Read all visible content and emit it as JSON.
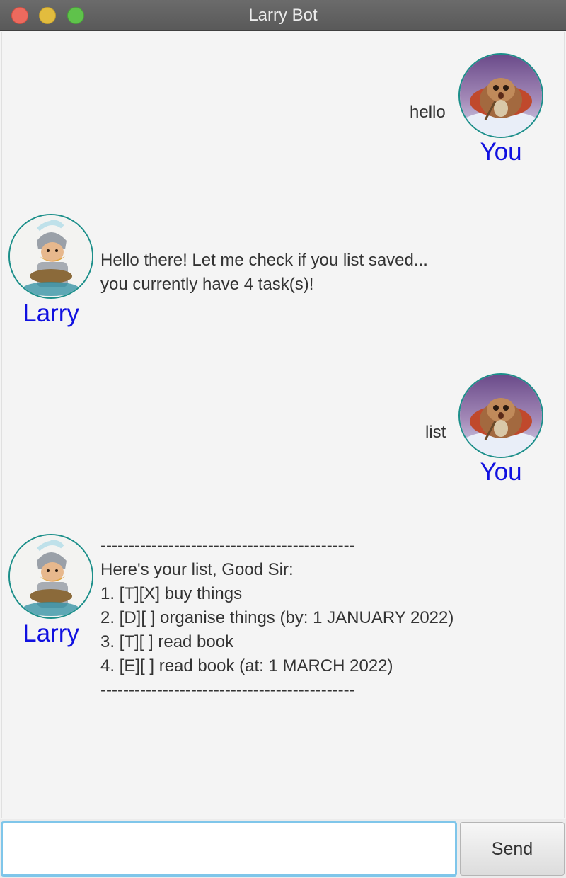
{
  "window": {
    "title": "Larry Bot"
  },
  "colors": {
    "speaker_name": "#1010e0",
    "avatar_border": "#1c8f8a",
    "input_focus_border": "#7fc6ea"
  },
  "messages": [
    {
      "sender": "You",
      "align": "right",
      "avatar_icon": "user-creature-avatar",
      "text": "hello"
    },
    {
      "sender": "Larry",
      "align": "left",
      "avatar_icon": "larry-knight-avatar",
      "text": "Hello there! Let me check if you list saved...\nyou currently have 4 task(s)!"
    },
    {
      "sender": "You",
      "align": "right",
      "avatar_icon": "user-creature-avatar",
      "text": "list"
    },
    {
      "sender": "Larry",
      "align": "left",
      "avatar_icon": "larry-knight-avatar",
      "text": "---------------------------------------------\nHere's your list, Good Sir:\n1. [T][X] buy things\n2. [D][ ] organise things (by: 1 JANUARY 2022)\n3. [T][ ] read book\n4. [E][ ] read book (at: 1 MARCH 2022)\n---------------------------------------------"
    }
  ],
  "input": {
    "value": "",
    "placeholder": ""
  },
  "send_button": {
    "label": "Send"
  }
}
